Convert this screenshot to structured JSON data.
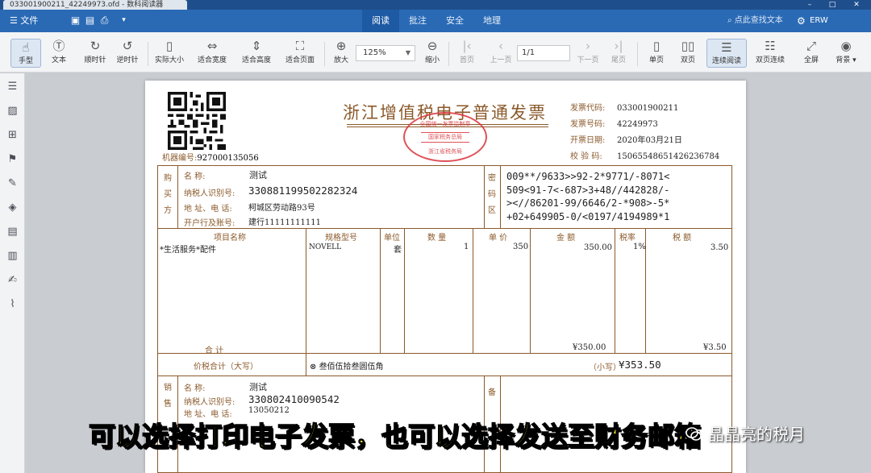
{
  "window": {
    "tab_title": "033001900211_42249973.ofd - 数科阅读器"
  },
  "menubar": {
    "file_label": "文件",
    "tabs": [
      {
        "label": "阅读",
        "active": true
      },
      {
        "label": "批注",
        "active": false
      },
      {
        "label": "安全",
        "active": false
      },
      {
        "label": "地理",
        "active": false
      }
    ],
    "search_label": "点此查找文本",
    "user_label": "ERW"
  },
  "toolbar": {
    "hand": "手型",
    "text": "文本",
    "rotate_cw": "顺时针",
    "rotate_ccw": "逆时针",
    "actual_size": "实际大小",
    "fit_width": "适合宽度",
    "fit_height": "适合高度",
    "fit_page": "适合页面",
    "zoom_in": "放大",
    "zoom_value": "125%",
    "zoom_out": "缩小",
    "first_page": "首页",
    "prev_page": "上一页",
    "page_value": "1/1",
    "next_page": "下一页",
    "last_page": "尾页",
    "single_page": "单页",
    "double_page": "双页",
    "continuous": "连续阅读",
    "double_continuous": "双页连续",
    "fullscreen": "全屏",
    "background": "背景"
  },
  "sidebar": {
    "icons": [
      "outline-icon",
      "image-icon",
      "tree-icon",
      "bookmark-icon",
      "annotation-icon",
      "layers-icon",
      "page-icon",
      "attachment-doc-icon",
      "form-icon",
      "paperclip-icon"
    ]
  },
  "invoice": {
    "title": "浙江增值税电子普通发票",
    "machine_label": "机器编号:",
    "machine_no": "927000135056",
    "seal": {
      "line1": "全国统一发票监制章",
      "line2": "国家税务总局",
      "line3": "浙江省税务局"
    },
    "meta": [
      {
        "label": "发票代码:",
        "value": "033001900211"
      },
      {
        "label": "发票号码:",
        "value": "42249973"
      },
      {
        "label": "开票日期:",
        "value": "2020年03月21日"
      },
      {
        "label": "校 验 码:",
        "value": "15065548651426236784"
      }
    ],
    "buyer": {
      "section_label": "购买方",
      "name_label": "名        称:",
      "name": "测试",
      "tax_id_label": "纳税人识别号:",
      "tax_id": "330881199502282324",
      "address_label": "地  址、电  话:",
      "address": "柯城区劳动路93号",
      "bank_label": "开户行及账号:",
      "bank": "建行11111111111"
    },
    "cipher_label": "密码区",
    "cipher": "009**/9633>>92-2*9771/-8071<\n509<91-7<-687>3+48//442828/-\n><//86201-99/6646/2-*908>-5*\n+02+649905-0/<0197/4194989*1",
    "headers": {
      "item": "项目名称",
      "spec": "规格型号",
      "unit": "单位",
      "qty": "数  量",
      "price": "单  价",
      "amount": "金  额",
      "rate": "税率",
      "tax": "税  额"
    },
    "items": [
      {
        "name": "*生活服务*配件",
        "spec": "NOVELL",
        "unit": "套",
        "qty": "1",
        "price": "350",
        "amount": "350.00",
        "rate": "1%",
        "tax": "3.50"
      }
    ],
    "total_label": "合        计",
    "total_amount": "¥350.00",
    "total_tax": "¥3.50",
    "grand_label": "价税合计（大写）",
    "grand_words": "叁佰伍拾叁圆伍角",
    "grand_small_label": "（小写）",
    "grand_small": "¥353.50",
    "seller": {
      "section_label": "销售",
      "name_label": "名        称:",
      "name": "测试",
      "tax_id_label": "纳税人识别号:",
      "tax_id": "330802410090542",
      "address_label": "地  址、电  话:",
      "address": "13050212"
    },
    "remark_label": "备"
  },
  "subtitle": "可以选择打印电子发票，也可以选择发送至财务邮箱",
  "watermark": "晶晶亮的税月",
  "colors": {
    "menubar": "#2a6ab5",
    "invoice_brown": "#8b5a2b",
    "seal_red": "#d9333a",
    "subtitle_yellow": "#fff22a"
  }
}
